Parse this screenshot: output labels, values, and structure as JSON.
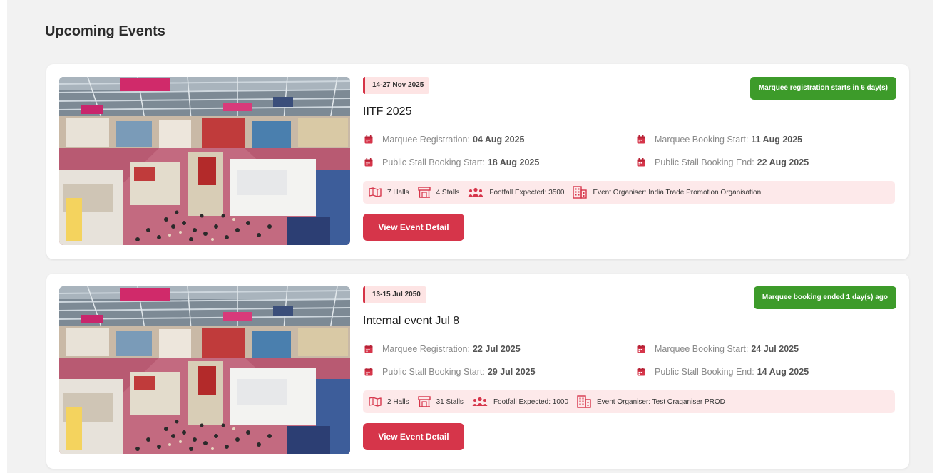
{
  "page": {
    "title": "Upcoming Events"
  },
  "colors": {
    "accent": "#d6354a",
    "status_green": "#3d9b2a",
    "stats_bg": "#fde9ea",
    "panel_bg": "#f2f2f2"
  },
  "icons": {
    "date_field": "calendar-icon",
    "halls": "map-icon",
    "stalls": "stall-icon",
    "footfall": "people-icon",
    "organiser": "building-icon"
  },
  "events": [
    {
      "date_range": "14-27 Nov 2025",
      "status": "Marquee registration starts in 6 day(s)",
      "name": "IITF 2025",
      "marquee_registration_label": "Marquee Registration:",
      "marquee_registration": "04 Aug 2025",
      "marquee_booking_start_label": "Marquee Booking Start:",
      "marquee_booking_start": "11 Aug 2025",
      "public_stall_booking_start_label": "Public Stall Booking Start:",
      "public_stall_booking_start": "18 Aug 2025",
      "public_stall_booking_end_label": "Public Stall Booking End:",
      "public_stall_booking_end": "22 Aug 2025",
      "halls": "7 Halls",
      "stalls": "4 Stalls",
      "footfall": "Footfall Expected: 3500",
      "organiser": "Event Organiser: India Trade Promotion Organisation",
      "button_label": "View Event Detail"
    },
    {
      "date_range": "13-15 Jul 2050",
      "status": "Marquee booking ended 1 day(s) ago",
      "name": "Internal event Jul 8",
      "marquee_registration_label": "Marquee Registration:",
      "marquee_registration": "22 Jul 2025",
      "marquee_booking_start_label": "Marquee Booking Start:",
      "marquee_booking_start": "24 Jul 2025",
      "public_stall_booking_start_label": "Public Stall Booking Start:",
      "public_stall_booking_start": "29 Jul 2025",
      "public_stall_booking_end_label": "Public Stall Booking End:",
      "public_stall_booking_end": "14 Aug 2025",
      "halls": "2 Halls",
      "stalls": "31 Stalls",
      "footfall": "Footfall Expected: 1000",
      "organiser": "Event Organiser: Test Oraganiser PROD",
      "button_label": "View Event Detail"
    }
  ]
}
